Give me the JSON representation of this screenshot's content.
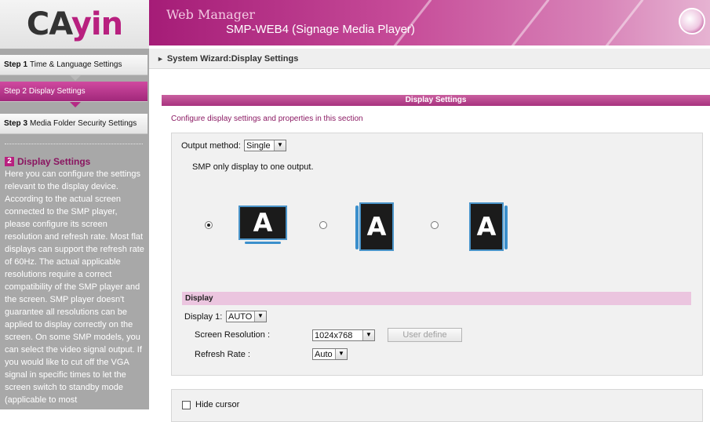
{
  "logo": {
    "part1": "CA",
    "part2": "yin"
  },
  "steps": [
    {
      "num": "Step 1",
      "label": "Time & Language Settings"
    },
    {
      "num": "Step 2",
      "label": "Display Settings"
    },
    {
      "num": "Step 3",
      "label": "Media Folder Security Settings"
    }
  ],
  "help": {
    "number": "2",
    "title": "Display Settings",
    "text": "Here you can configure the settings relevant to the display device. According to the actual screen connected to the SMP player, please configure its screen resolution and refresh rate. Most flat displays can support the refresh rate of 60Hz. The actual applicable resolutions require a correct compatibility of the SMP player and the screen. SMP player doesn't guarantee all resolutions can be applied to display correctly on the screen. On some SMP models, you can select the video signal output. If you would like to cut off the VGA signal in specific times to let the screen switch to standby mode (applicable to most"
  },
  "header": {
    "title": "Web Manager",
    "subtitle": "SMP-WEB4 (Signage Media Player)"
  },
  "breadcrumb": {
    "text": "System Wizard:Display Settings"
  },
  "panel": {
    "title": "Display Settings",
    "description": "Configure display settings and properties in this section"
  },
  "output": {
    "label": "Output method:",
    "value": "Single",
    "note": "SMP only display to one output.",
    "orientations": [
      {
        "glyph": "A",
        "selected": true
      },
      {
        "glyph": "A",
        "selected": false
      },
      {
        "glyph": "A",
        "selected": false
      }
    ]
  },
  "display": {
    "section": "Display",
    "display1_label": "Display 1:",
    "display1_value": "AUTO",
    "resolution_label": "Screen Resolution :",
    "resolution_value": "1024x768",
    "user_define": "User define",
    "refresh_label": "Refresh Rate :",
    "refresh_value": "Auto"
  },
  "hide_cursor": {
    "label": "Hide cursor",
    "checked": false
  },
  "colors": {
    "accent": "#b8207f",
    "monitor_frame": "#3b8fcc"
  }
}
